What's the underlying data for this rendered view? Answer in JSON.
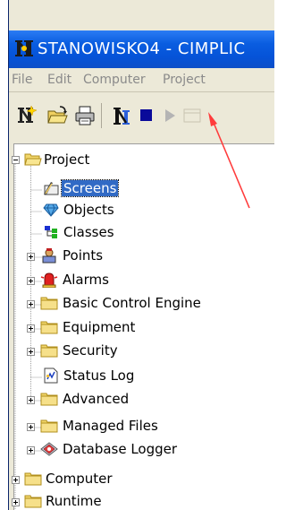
{
  "window": {
    "title": "STANOWISKO4 - CIMPLIC"
  },
  "menu": [
    "File",
    "Edit",
    "Computer",
    "Project"
  ],
  "toolbar": [
    "new-project",
    "open",
    "print",
    "run",
    "stop",
    "play",
    "disabled-tool"
  ],
  "tree": {
    "root": "Project",
    "items": [
      {
        "label": "Screens",
        "icon": "screens-icon",
        "selected": true,
        "expander": "none"
      },
      {
        "label": "Objects",
        "icon": "objects-icon",
        "expander": "none"
      },
      {
        "label": "Classes",
        "icon": "classes-icon",
        "expander": "none"
      },
      {
        "label": "Points",
        "icon": "points-icon",
        "expander": "plus"
      },
      {
        "label": "Alarms",
        "icon": "alarms-icon",
        "expander": "plus"
      },
      {
        "label": "Basic Control Engine",
        "icon": "folder-icon",
        "expander": "plus"
      },
      {
        "label": "Equipment",
        "icon": "folder-icon",
        "expander": "plus"
      },
      {
        "label": "Security",
        "icon": "folder-icon",
        "expander": "plus"
      },
      {
        "label": "Status Log",
        "icon": "status-log-icon",
        "expander": "none"
      },
      {
        "label": "Advanced",
        "icon": "folder-icon",
        "expander": "plus"
      },
      {
        "label": "Managed Files",
        "icon": "folder-icon",
        "expander": "plus"
      },
      {
        "label": "Database Logger",
        "icon": "database-logger-icon",
        "expander": "plus"
      }
    ],
    "bottom": [
      {
        "label": "Computer",
        "icon": "folder-icon",
        "expander": "plus"
      },
      {
        "label": "Runtime",
        "icon": "folder-icon",
        "expander": "plus"
      }
    ]
  },
  "colors": {
    "titlebar": "#0553d8",
    "selection": "#316ac5",
    "annotation_arrow": "#ff3b3b",
    "stop_button": "#0a0a9a"
  }
}
